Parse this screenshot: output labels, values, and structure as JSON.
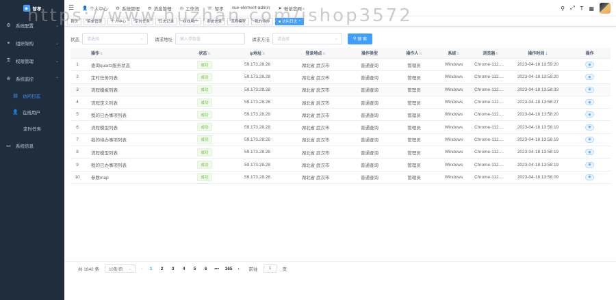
{
  "sidebar": {
    "logo_text": "智孝",
    "menu": [
      {
        "label": "系统配置",
        "icon": "gear-icon"
      },
      {
        "label": "组织架构",
        "icon": "org-icon"
      },
      {
        "label": "权限管理",
        "icon": "lock-icon"
      },
      {
        "label": "系统监控",
        "icon": "monitor-icon"
      }
    ],
    "sub": [
      {
        "label": "访问日志"
      },
      {
        "label": "在线用户"
      },
      {
        "label": "定时任务"
      }
    ],
    "last": {
      "label": "系统信息"
    }
  },
  "navbar": {
    "items": [
      "个人中心",
      "系统管理",
      "消息管理",
      "工作流",
      "智孝",
      "vue-element-admin",
      "若依官网"
    ]
  },
  "tags": [
    "首页",
    "菜单管理",
    "个人中心",
    "定时任务",
    "日志记录",
    "在线用户",
    "系统信息",
    "流程模型",
    "我的待办",
    "访问日志"
  ],
  "search": {
    "status_label": "状态",
    "status_placeholder": "请选择",
    "url_label": "请求地址",
    "url_placeholder": "输入参数值",
    "method_label": "请求方法",
    "method_placeholder": "请选择",
    "button": "搜 索"
  },
  "table": {
    "headers": [
      "操作",
      "状态",
      "ip地址",
      "登录地点",
      "操作类型",
      "操作人",
      "系统",
      "浏览器",
      "操作时间",
      "操作"
    ],
    "rows": [
      {
        "idx": "1",
        "op": "查询quartz服务状态",
        "status": "成功",
        "ip": "59.173.28.28",
        "loc": "湖北省 武汉市",
        "type": "普通查询",
        "user": "管理员",
        "os": "Windows",
        "browser": "Chrome-112....",
        "time": "2023-04-18 13:59:20"
      },
      {
        "idx": "2",
        "op": "定时任务列表",
        "status": "成功",
        "ip": "59.173.28.28",
        "loc": "湖北省 武汉市",
        "type": "普通查询",
        "user": "管理员",
        "os": "Windows",
        "browser": "Chrome-112....",
        "time": "2023-04-18 13:59:20"
      },
      {
        "idx": "3",
        "op": "流程模板列表",
        "status": "成功",
        "ip": "59.173.28.28",
        "loc": "湖北省 武汉市",
        "type": "普通查询",
        "user": "管理员",
        "os": "Windows",
        "browser": "Chrome-112....",
        "time": "2023-04-18 13:58:33"
      },
      {
        "idx": "4",
        "op": "流程定义列表",
        "status": "成功",
        "ip": "59.173.28.28",
        "loc": "湖北省 武汉市",
        "type": "普通查询",
        "user": "管理员",
        "os": "Windows",
        "browser": "Chrome-112....",
        "time": "2023-04-18 13:58:27"
      },
      {
        "idx": "5",
        "op": "我的已办事项列表",
        "status": "成功",
        "ip": "59.173.28.28",
        "loc": "湖北省 武汉市",
        "type": "普通查询",
        "user": "管理员",
        "os": "Windows",
        "browser": "Chrome-112....",
        "time": "2023-04-18 13:58:20"
      },
      {
        "idx": "6",
        "op": "流程模型列表",
        "status": "成功",
        "ip": "59.173.28.28",
        "loc": "湖北省 武汉市",
        "type": "普通查询",
        "user": "管理员",
        "os": "Windows",
        "browser": "Chrome-112....",
        "time": "2023-04-18 13:58:19"
      },
      {
        "idx": "7",
        "op": "我的待办事项列表",
        "status": "成功",
        "ip": "59.173.28.28",
        "loc": "湖北省 武汉市",
        "type": "普通查询",
        "user": "管理员",
        "os": "Windows",
        "browser": "Chrome-112....",
        "time": "2023-04-18 13:58:19"
      },
      {
        "idx": "8",
        "op": "流程模型列表",
        "status": "成功",
        "ip": "59.173.28.28",
        "loc": "湖北省 武汉市",
        "type": "普通查询",
        "user": "管理员",
        "os": "Windows",
        "browser": "Chrome-112....",
        "time": "2023-04-18 13:58:19"
      },
      {
        "idx": "9",
        "op": "我的已办事项列表",
        "status": "成功",
        "ip": "59.173.28.28",
        "loc": "湖北省 武汉市",
        "type": "普通查询",
        "user": "管理员",
        "os": "Windows",
        "browser": "Chrome-112....",
        "time": "2023-04-18 13:58:19"
      },
      {
        "idx": "10",
        "op": "参数map",
        "status": "成功",
        "ip": "59.173.28.28",
        "loc": "湖北省 武汉市",
        "type": "普通查询",
        "user": "管理员",
        "os": "Windows",
        "browser": "Chrome-112....",
        "time": "2023-04-18 13:58:09"
      }
    ]
  },
  "pagination": {
    "total": "共 1642 条",
    "page_size": "10条/页",
    "pages": [
      "1",
      "2",
      "3",
      "4",
      "5",
      "6",
      "•••",
      "165"
    ],
    "goto_label": "前往",
    "goto_value": "1",
    "goto_suffix": "页"
  },
  "watermark": "https://www.huzhan.com/ishop3572",
  "colors": {
    "sidebar_bg": "#1f2d3d",
    "primary": "#409eff",
    "success": "#67c23a"
  }
}
